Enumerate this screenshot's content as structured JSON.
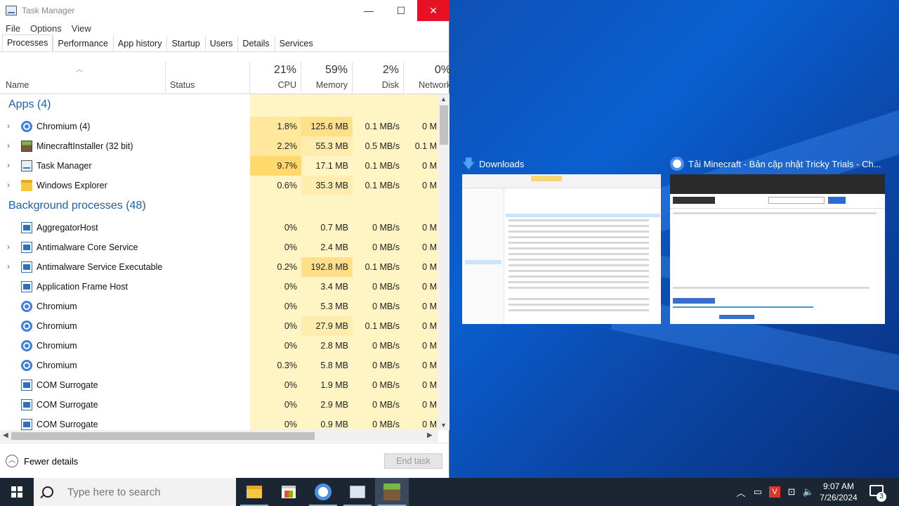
{
  "window": {
    "title": "Task Manager",
    "minimize": "—",
    "maximize": "☐",
    "close": "✕"
  },
  "menu": [
    "File",
    "Options",
    "View"
  ],
  "tabs": [
    "Processes",
    "Performance",
    "App history",
    "Startup",
    "Users",
    "Details",
    "Services"
  ],
  "header": {
    "name": "Name",
    "status": "Status",
    "cpu_pct": "21%",
    "cpu": "CPU",
    "mem_pct": "59%",
    "mem": "Memory",
    "disk_pct": "2%",
    "disk": "Disk",
    "net_pct": "0%",
    "net": "Network"
  },
  "groups": {
    "apps": "Apps (4)",
    "background": "Background processes (48)"
  },
  "apps": [
    {
      "name": "Chromium (4)",
      "cpu": "1.8%",
      "mem": "125.6 MB",
      "disk": "0.1 MB/s",
      "net": "0 M"
    },
    {
      "name": "MinecraftInstaller (32 bit)",
      "cpu": "2.2%",
      "mem": "55.3 MB",
      "disk": "0.5 MB/s",
      "net": "0.1 M"
    },
    {
      "name": "Task Manager",
      "cpu": "9.7%",
      "mem": "17.1 MB",
      "disk": "0.1 MB/s",
      "net": "0 M"
    },
    {
      "name": "Windows Explorer",
      "cpu": "0.6%",
      "mem": "35.3 MB",
      "disk": "0.1 MB/s",
      "net": "0 M"
    }
  ],
  "background": [
    {
      "name": "AggregatorHost",
      "cpu": "0%",
      "mem": "0.7 MB",
      "disk": "0 MB/s",
      "net": "0 M"
    },
    {
      "name": "Antimalware Core Service",
      "cpu": "0%",
      "mem": "2.4 MB",
      "disk": "0 MB/s",
      "net": "0 M"
    },
    {
      "name": "Antimalware Service Executable",
      "cpu": "0.2%",
      "mem": "192.8 MB",
      "disk": "0.1 MB/s",
      "net": "0 M"
    },
    {
      "name": "Application Frame Host",
      "cpu": "0%",
      "mem": "3.4 MB",
      "disk": "0 MB/s",
      "net": "0 M"
    },
    {
      "name": "Chromium",
      "cpu": "0%",
      "mem": "5.3 MB",
      "disk": "0 MB/s",
      "net": "0 M"
    },
    {
      "name": "Chromium",
      "cpu": "0%",
      "mem": "27.9 MB",
      "disk": "0.1 MB/s",
      "net": "0 M"
    },
    {
      "name": "Chromium",
      "cpu": "0%",
      "mem": "2.8 MB",
      "disk": "0 MB/s",
      "net": "0 M"
    },
    {
      "name": "Chromium",
      "cpu": "0.3%",
      "mem": "5.8 MB",
      "disk": "0 MB/s",
      "net": "0 M"
    },
    {
      "name": "COM Surrogate",
      "cpu": "0%",
      "mem": "1.9 MB",
      "disk": "0 MB/s",
      "net": "0 M"
    },
    {
      "name": "COM Surrogate",
      "cpu": "0%",
      "mem": "2.9 MB",
      "disk": "0 MB/s",
      "net": "0 M"
    },
    {
      "name": "COM Surrogate",
      "cpu": "0%",
      "mem": "0.9 MB",
      "disk": "0 MB/s",
      "net": "0 M"
    }
  ],
  "footer": {
    "fewer_details": "Fewer details",
    "end_task": "End task"
  },
  "previews": {
    "downloads": "Downloads",
    "browser": "Tải Minecraft - Bản cập nhật Tricky Trials - Ch..."
  },
  "taskbar": {
    "search_placeholder": "Type here to search",
    "time": "9:07 AM",
    "date": "7/26/2024",
    "notifications": "3"
  },
  "colors": {
    "close_red": "#e81123",
    "heat_light": "#fff4c4",
    "heat_mid": "#ffe89c",
    "heat_strong": "#ffd96b",
    "group_blue": "#1f5fa8",
    "taskbar": "#1c2633"
  }
}
